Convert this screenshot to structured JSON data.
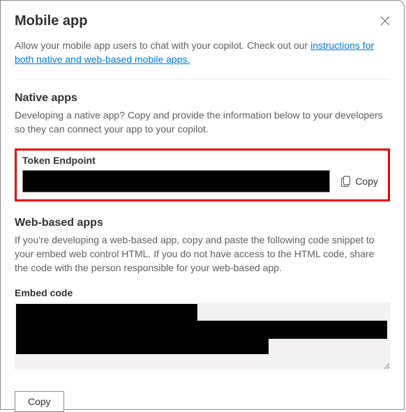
{
  "header": {
    "title": "Mobile app"
  },
  "intro": {
    "text": "Allow your mobile app users to chat with your copilot. Check out our ",
    "link_text": "instructions for both native and web-based mobile apps."
  },
  "native": {
    "heading": "Native apps",
    "desc": "Developing a native app? Copy and provide the information below to your developers so they can connect your app to your copilot.",
    "field_label": "Token Endpoint",
    "field_value": "",
    "copy_label": "Copy"
  },
  "web": {
    "heading": "Web-based apps",
    "desc": "If you're developing a web-based app, copy and paste the following code snippet to your embed web control HTML. If you do not have access to the HTML code, share the code with the person responsible for your web-based app.",
    "field_label": "Embed code",
    "field_value": "",
    "copy_label": "Copy"
  }
}
